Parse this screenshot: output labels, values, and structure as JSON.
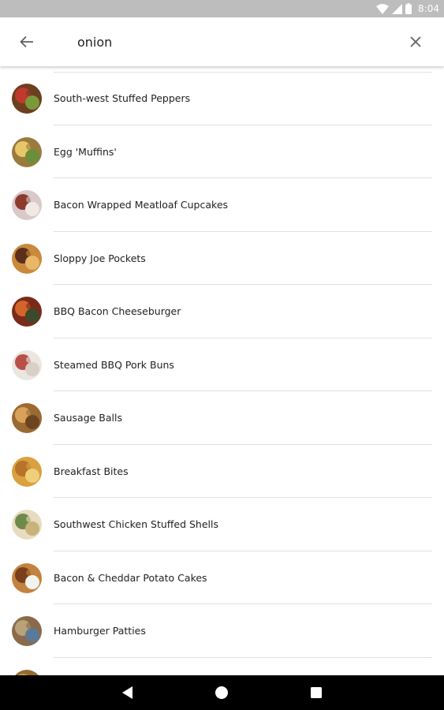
{
  "status_bar": {
    "time": "8:04",
    "icons": [
      "wifi-icon",
      "signal-icon",
      "battery-icon"
    ],
    "background": "#bdbdbd"
  },
  "search": {
    "query": "onion",
    "back_icon": "arrow-back-icon",
    "clear_icon": "close-icon"
  },
  "results": [
    {
      "title": "South-west Stuffed Peppers",
      "thumb_colors": [
        "#6b3f1f",
        "#c0392b",
        "#7a9a3a"
      ]
    },
    {
      "title": "Egg 'Muffins'",
      "thumb_colors": [
        "#9b7a3e",
        "#e6c86b",
        "#6b8e3a"
      ]
    },
    {
      "title": "Bacon Wrapped Meatloaf Cupcakes",
      "thumb_colors": [
        "#d9c9c9",
        "#8e3b2e",
        "#f2e9e4"
      ]
    },
    {
      "title": "Sloppy Joe Pockets",
      "thumb_colors": [
        "#c98a3c",
        "#5a2f1c",
        "#e8b768"
      ]
    },
    {
      "title": "BBQ Bacon Cheeseburger",
      "thumb_colors": [
        "#7a2a1a",
        "#d4652a",
        "#3a4a2a"
      ]
    },
    {
      "title": "Steamed BBQ Pork Buns",
      "thumb_colors": [
        "#ece6e0",
        "#b8504a",
        "#d8cfc7"
      ]
    },
    {
      "title": "Sausage Balls",
      "thumb_colors": [
        "#9a6a32",
        "#d9a25a",
        "#6b4520"
      ]
    },
    {
      "title": "Breakfast Bites",
      "thumb_colors": [
        "#d9a13f",
        "#b8732a",
        "#f0cf7a"
      ]
    },
    {
      "title": "Southwest Chicken Stuffed Shells",
      "thumb_colors": [
        "#e7dcc0",
        "#6e8a4a",
        "#c8b37a"
      ]
    },
    {
      "title": "Bacon & Cheddar Potato Cakes",
      "thumb_colors": [
        "#c48240",
        "#7a3f1a",
        "#f2f2ee"
      ]
    },
    {
      "title": "Hamburger Patties",
      "thumb_colors": [
        "#8a6a4a",
        "#b9a27a",
        "#5a7a9a"
      ]
    },
    {
      "title": "",
      "thumb_colors": [
        "#9a6a32",
        "#c89a4a",
        "#6b4520"
      ]
    }
  ],
  "nav_bar": {
    "buttons": [
      "nav-back-icon",
      "nav-home-icon",
      "nav-recents-icon"
    ]
  }
}
